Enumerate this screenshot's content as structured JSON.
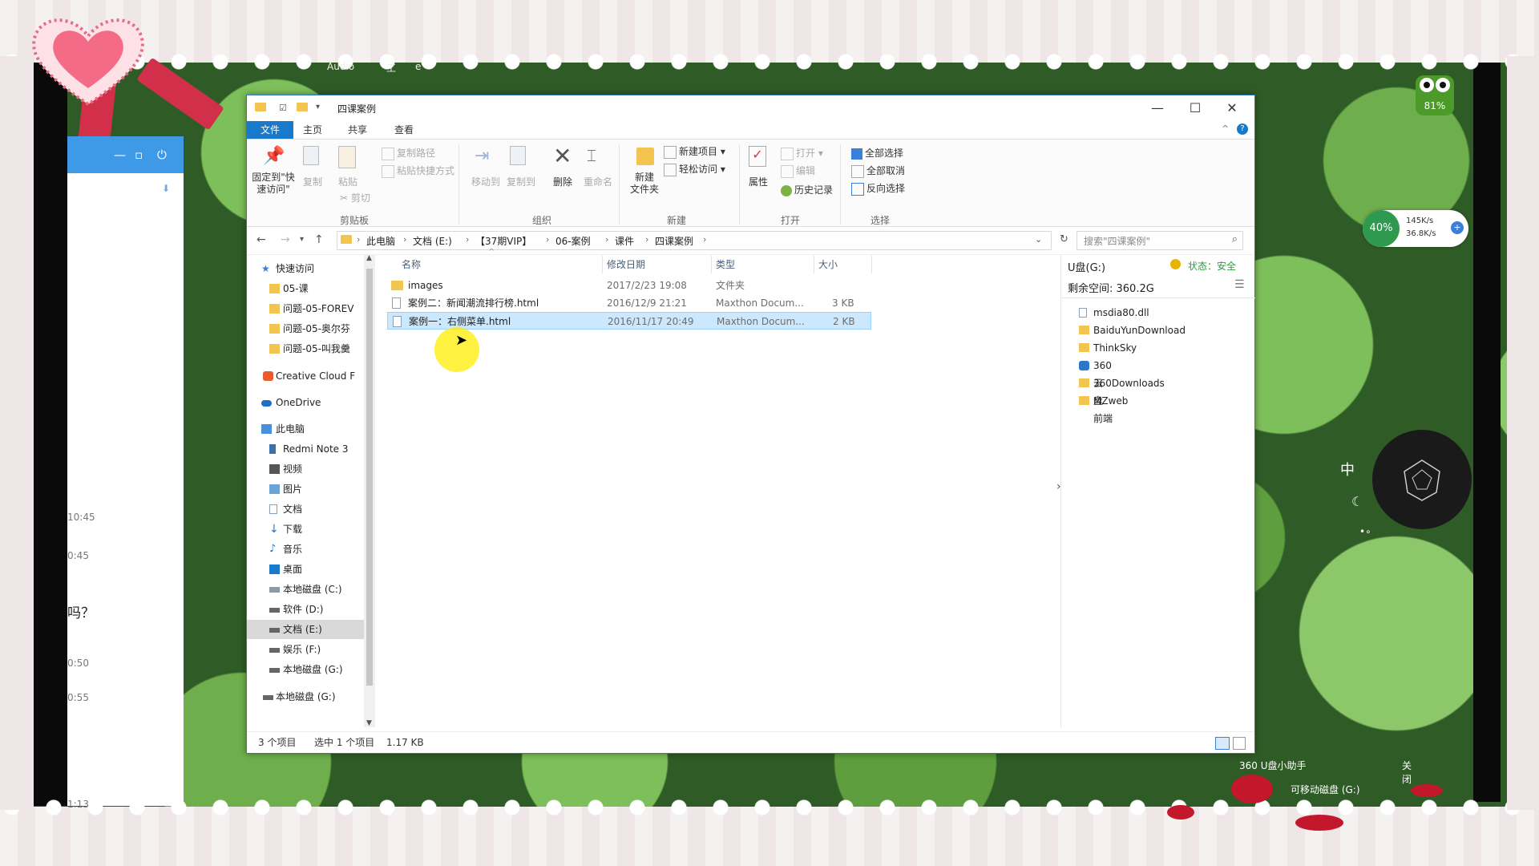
{
  "desktop": {
    "top_labels": [
      "Audio",
      "工",
      "e"
    ],
    "ime_label": "中",
    "owl_badge": "81%",
    "net": {
      "percent": "40%",
      "upload": "145K/s",
      "download": "36.8K/s"
    },
    "usb_helper": {
      "title": "360 U盘小助手",
      "close": "关闭",
      "line1": "可移动磁盘 (G:)"
    }
  },
  "chat": {
    "times": [
      "10:45",
      "0:45",
      "0:50",
      "0:55",
      "1:13"
    ],
    "question": "吗？"
  },
  "window": {
    "title": "四课案例",
    "tabs": [
      "文件",
      "主页",
      "共享",
      "查看"
    ],
    "controls": {
      "minimize": "—",
      "maximize": "☐",
      "close": "✕"
    },
    "ribbon": {
      "clipboard": {
        "pin": "固定到\"快速访问\"",
        "copy": "复制",
        "paste": "粘贴",
        "copy_path": "复制路径",
        "paste_shortcut": "粘贴快捷方式",
        "cut": "剪切",
        "group": "剪贴板"
      },
      "organize": {
        "move_to": "移动到",
        "copy_to": "复制到",
        "delete": "删除",
        "rename": "重命名",
        "group": "组织"
      },
      "new": {
        "new_folder": "新建\n文件夹",
        "new_item": "新建项目 ▾",
        "easy_access": "轻松访问 ▾",
        "group": "新建"
      },
      "open": {
        "properties": "属性",
        "open": "打开 ▾",
        "edit": "编辑",
        "history": "历史记录",
        "group": "打开"
      },
      "select": {
        "select_all": "全部选择",
        "select_none": "全部取消",
        "invert": "反向选择",
        "group": "选择"
      }
    },
    "address": {
      "crumbs": [
        "此电脑",
        "文档 (E:)",
        "【37期VIP】",
        "06-案例",
        "课件",
        "四课案例"
      ]
    },
    "search": {
      "placeholder": "搜索\"四课案例\""
    },
    "nav": {
      "quick_access": "快速访问",
      "items": [
        "05-课",
        "问题-05-FOREV",
        "问题-05-奥尔芬",
        "问题-05-叫我羹"
      ],
      "creative_cloud": "Creative Cloud F",
      "onedrive": "OneDrive",
      "this_pc": "此电脑",
      "pc_items": [
        "Redmi Note 3",
        "视频",
        "图片",
        "文档",
        "下载",
        "音乐",
        "桌面",
        "本地磁盘 (C:)",
        "软件 (D:)",
        "文档 (E:)",
        "娱乐 (F:)",
        "本地磁盘 (G:)"
      ],
      "bottom": "本地磁盘 (G:)"
    },
    "columns": {
      "name": "名称",
      "modified": "修改日期",
      "type": "类型",
      "size": "大小"
    },
    "files": [
      {
        "name": "images",
        "modified": "2017/2/23 19:08",
        "type": "文件夹",
        "size": ""
      },
      {
        "name": "案例二：新闻潮流排行榜.html",
        "modified": "2016/12/9 21:21",
        "type": "Maxthon Docum...",
        "size": "3 KB"
      },
      {
        "name": "案例一：右侧菜单.html",
        "modified": "2016/11/17 20:49",
        "type": "Maxthon Docum...",
        "size": "2 KB"
      }
    ],
    "side_panel": {
      "drive": "U盘(G:)",
      "status": "状态：安全",
      "free": "剩余空间: 360.2G",
      "items": [
        "msdia80.dll",
        "BaiduYunDownload",
        "ThinkSky",
        "360云盘",
        "360Downloads",
        "MZweb前端"
      ]
    },
    "status": {
      "count": "3 个项目",
      "selected": "选中 1 个项目",
      "size": "1.17 KB"
    }
  }
}
